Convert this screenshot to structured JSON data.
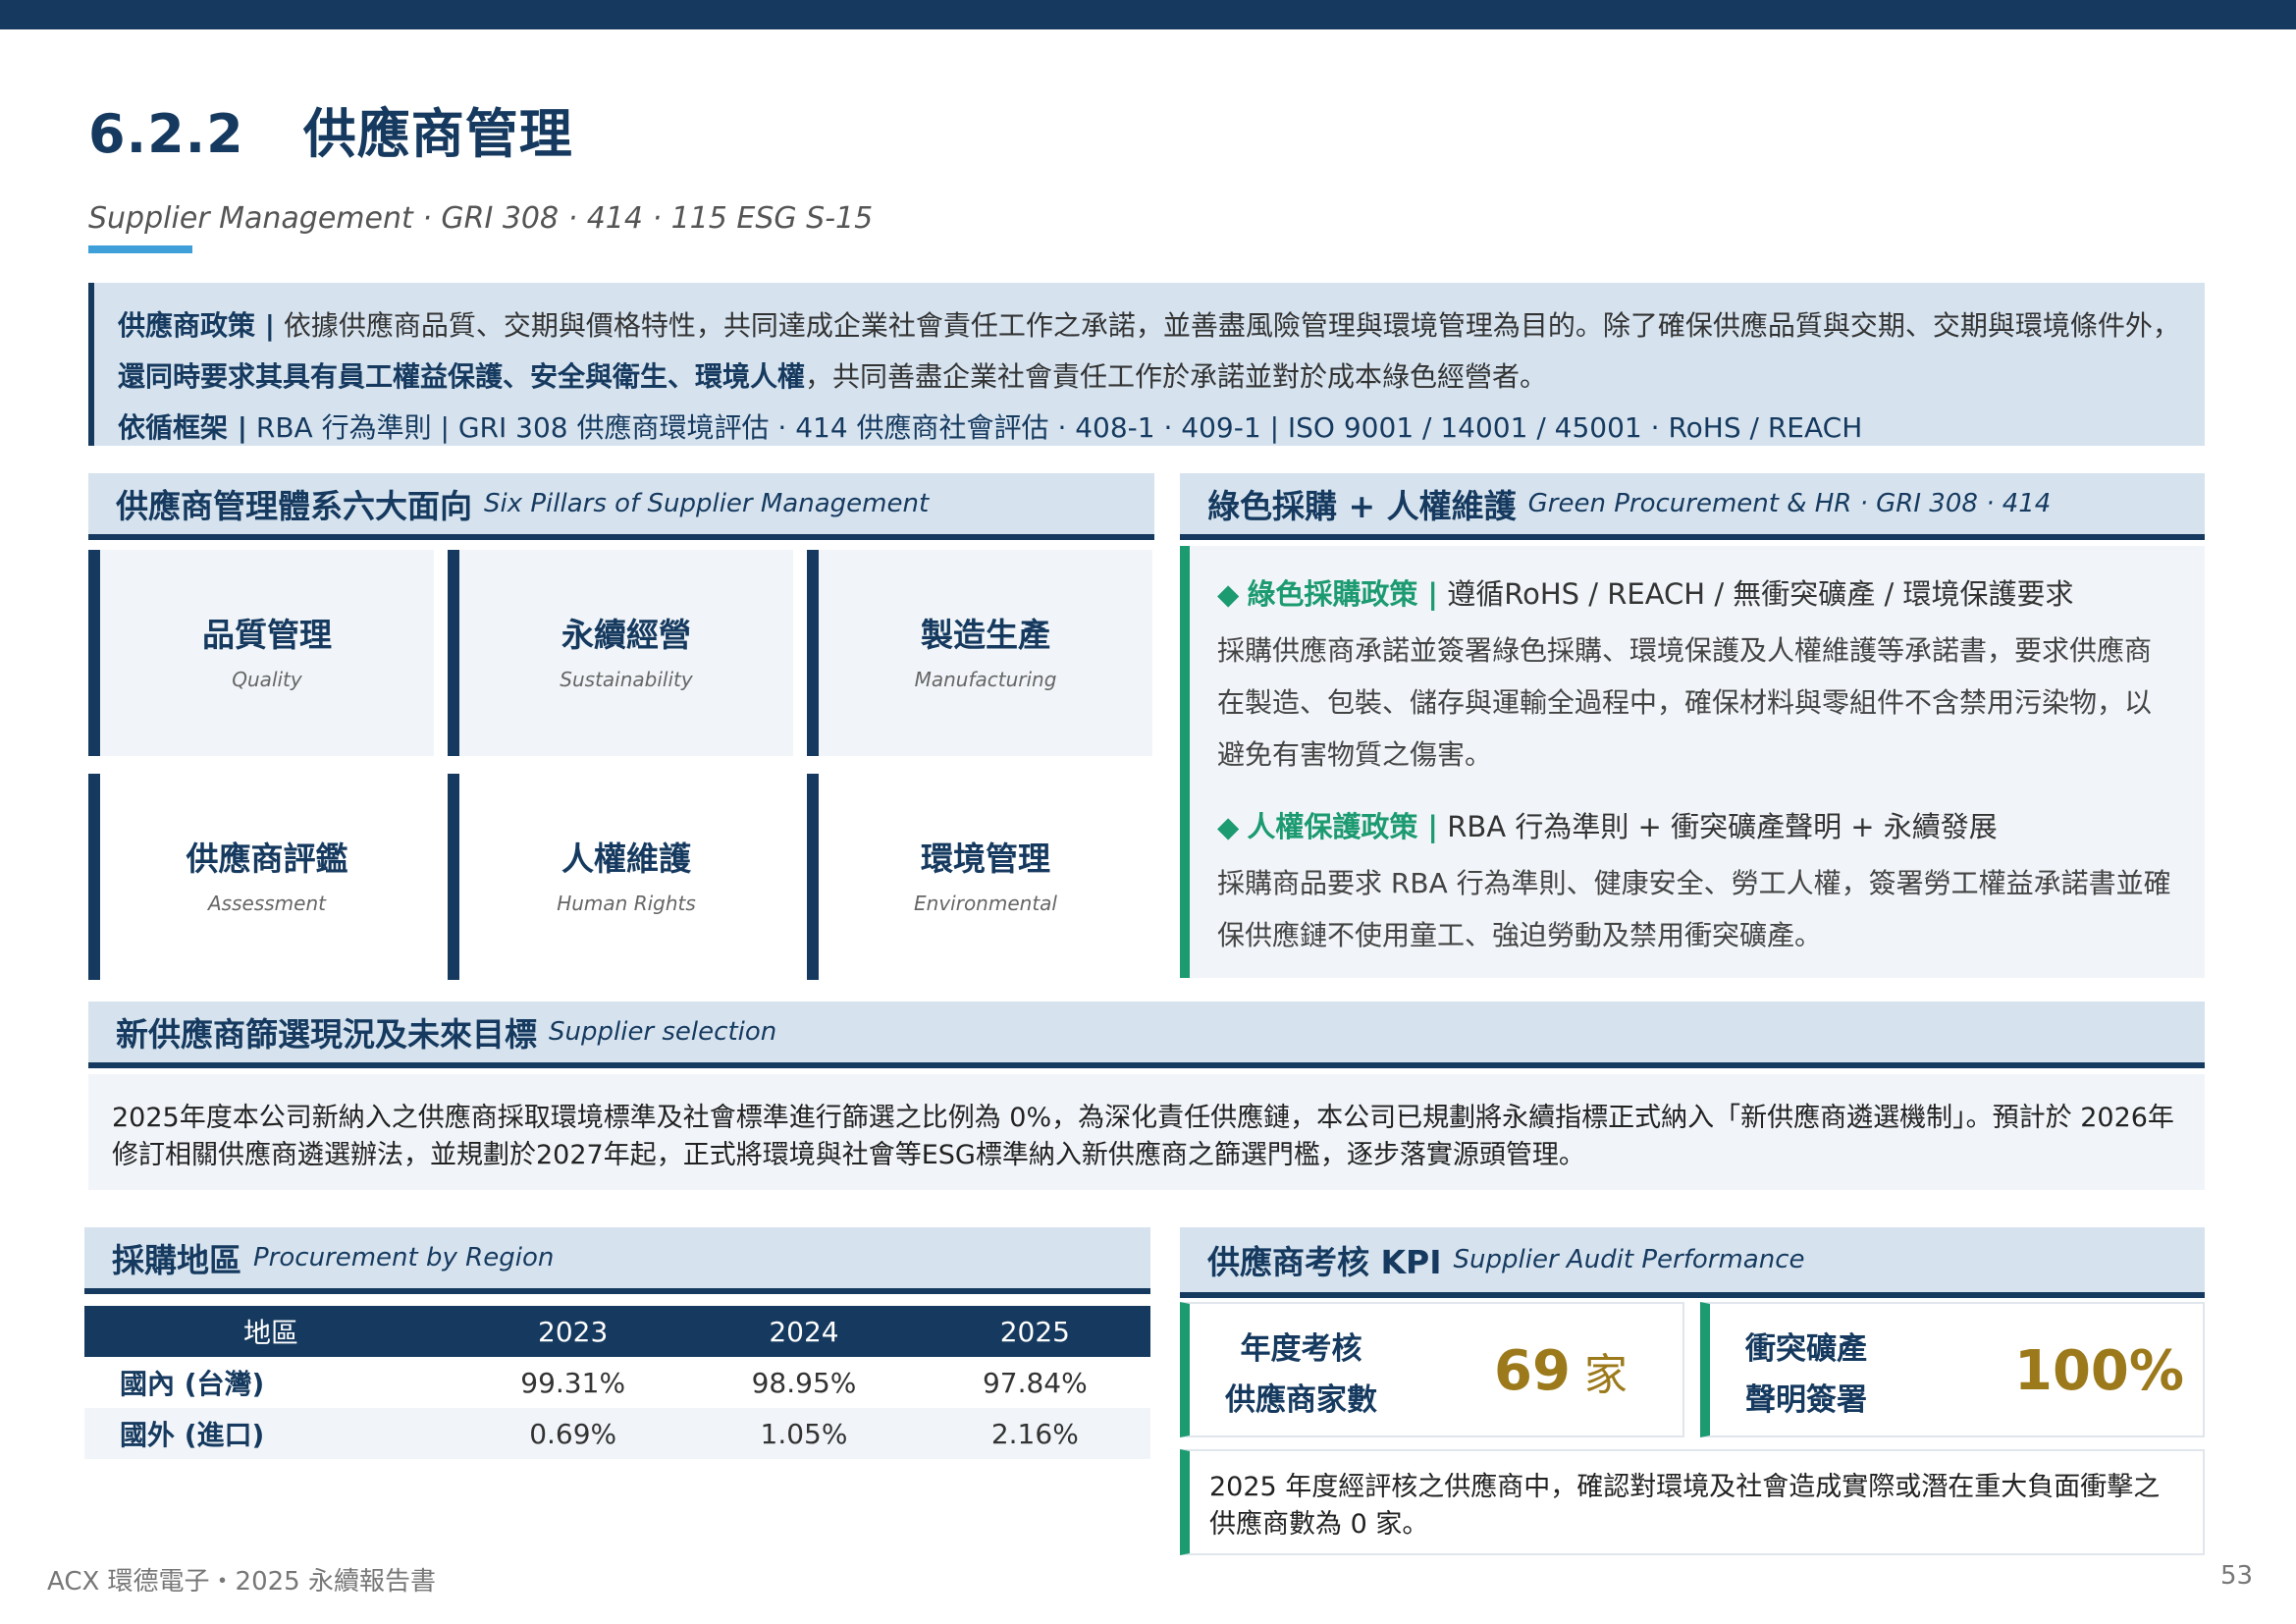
{
  "header": {
    "section_number": "6.2.2",
    "section_title": "供應商管理",
    "subtitle": "Supplier Management · GRI 308 · 414 · 115 ESG S-15"
  },
  "policy": {
    "label1": "供應商政策 |",
    "text1": " 依據供應商品質、交期與價格特性，共同達成企業社會責任工作之承諾，並善盡風險管理與環境管理為目的。除了確保供應品質與交期、交期與環境條件外，",
    "bold1": "還同時要求其具有員工權益保護、安全與衛生、環境人權",
    "text2": "，共同善盡企業社會責任工作於承諾並對於成本綠色經營者。",
    "framework_label": "依循框架 |",
    "framework_text": " RBA 行為準則  |  GRI 308 供應商環境評估 · 414 供應商社會評估 · 408-1 · 409-1  |  ISO 9001 / 14001 / 45001 · RoHS / REACH"
  },
  "pillars_section": {
    "title_zh": "供應商管理體系六大面向",
    "title_en": "Six Pillars of Supplier Management",
    "items": [
      {
        "zh": "品質管理",
        "en": "Quality"
      },
      {
        "zh": "永續經營",
        "en": "Sustainability"
      },
      {
        "zh": "製造生產",
        "en": "Manufacturing"
      },
      {
        "zh": "供應商評鑑",
        "en": "Assessment"
      },
      {
        "zh": "人權維護",
        "en": "Human Rights"
      },
      {
        "zh": "環境管理",
        "en": "Environmental"
      }
    ]
  },
  "green_section": {
    "title_zh": "綠色採購 + 人權維護",
    "title_en": "Green Procurement & HR · GRI 308 · 414",
    "green_policy_title": "綠色採購政策 |",
    "green_policy_head": " 遵循RoHS / REACH / 無衝突礦產 / 環境保護要求",
    "green_policy_body": "採購供應商承諾並簽署綠色採購、環境保護及人權維護等承諾書，要求供應商在製造、包裝、儲存與運輸全過程中，確保材料與零組件不含禁用污染物，以避免有害物質之傷害。",
    "hr_policy_title": "人權保護政策 |",
    "hr_policy_head": " RBA 行為準則 + 衝突礦產聲明 + 永續發展",
    "hr_policy_body": "採購商品要求 RBA 行為準則、健康安全、勞工人權，簽署勞工權益承諾書並確保供應鏈不使用童工、強迫勞動及禁用衝突礦產。"
  },
  "screening_section": {
    "title_zh": "新供應商篩選現況及未來目標",
    "title_en": "Supplier selection",
    "body": "2025年度本公司新納入之供應商採取環境標準及社會標準進行篩選之比例為 0%，為深化責任供應鏈，本公司已規劃將永續指標正式納入「新供應商遴選機制」。預計於 2026年修訂相關供應商遴選辦法，並規劃於2027年起，正式將環境與社會等ESG標準納入新供應商之篩選門檻，逐步落實源頭管理。"
  },
  "region_section": {
    "title_zh": "採購地區",
    "title_en": "Procurement by Region",
    "columns": [
      "地區",
      "2023",
      "2024",
      "2025"
    ],
    "rows": [
      [
        "國內 (台灣)",
        "99.31%",
        "98.95%",
        "97.84%"
      ],
      [
        "國外 (進口)",
        "0.69%",
        "1.05%",
        "2.16%"
      ]
    ]
  },
  "kpi_section": {
    "title_zh": "供應商考核 KPI",
    "title_en": "Supplier Audit Performance",
    "kpi1_line1": "年度考核",
    "kpi1_line2": "供應商家數",
    "kpi1_value": "69",
    "kpi1_unit": " 家",
    "kpi2_line1": "衝突礦產",
    "kpi2_line2": "聲明簽署",
    "kpi2_value": "100%",
    "note": "2025 年度經評核之供應商中，確認對環境及社會造成實際或潛在重大負面衝擊之供應商數為 0 家。"
  },
  "footer": {
    "left": "ACX 環德電子・2025 永續報告書",
    "page": "53"
  },
  "colors": {
    "navy": "#163a5f",
    "light_blue": "#d6e3ef",
    "green": "#1c9a70",
    "gold": "#9c7a1c",
    "accent": "#3f9fd8"
  }
}
